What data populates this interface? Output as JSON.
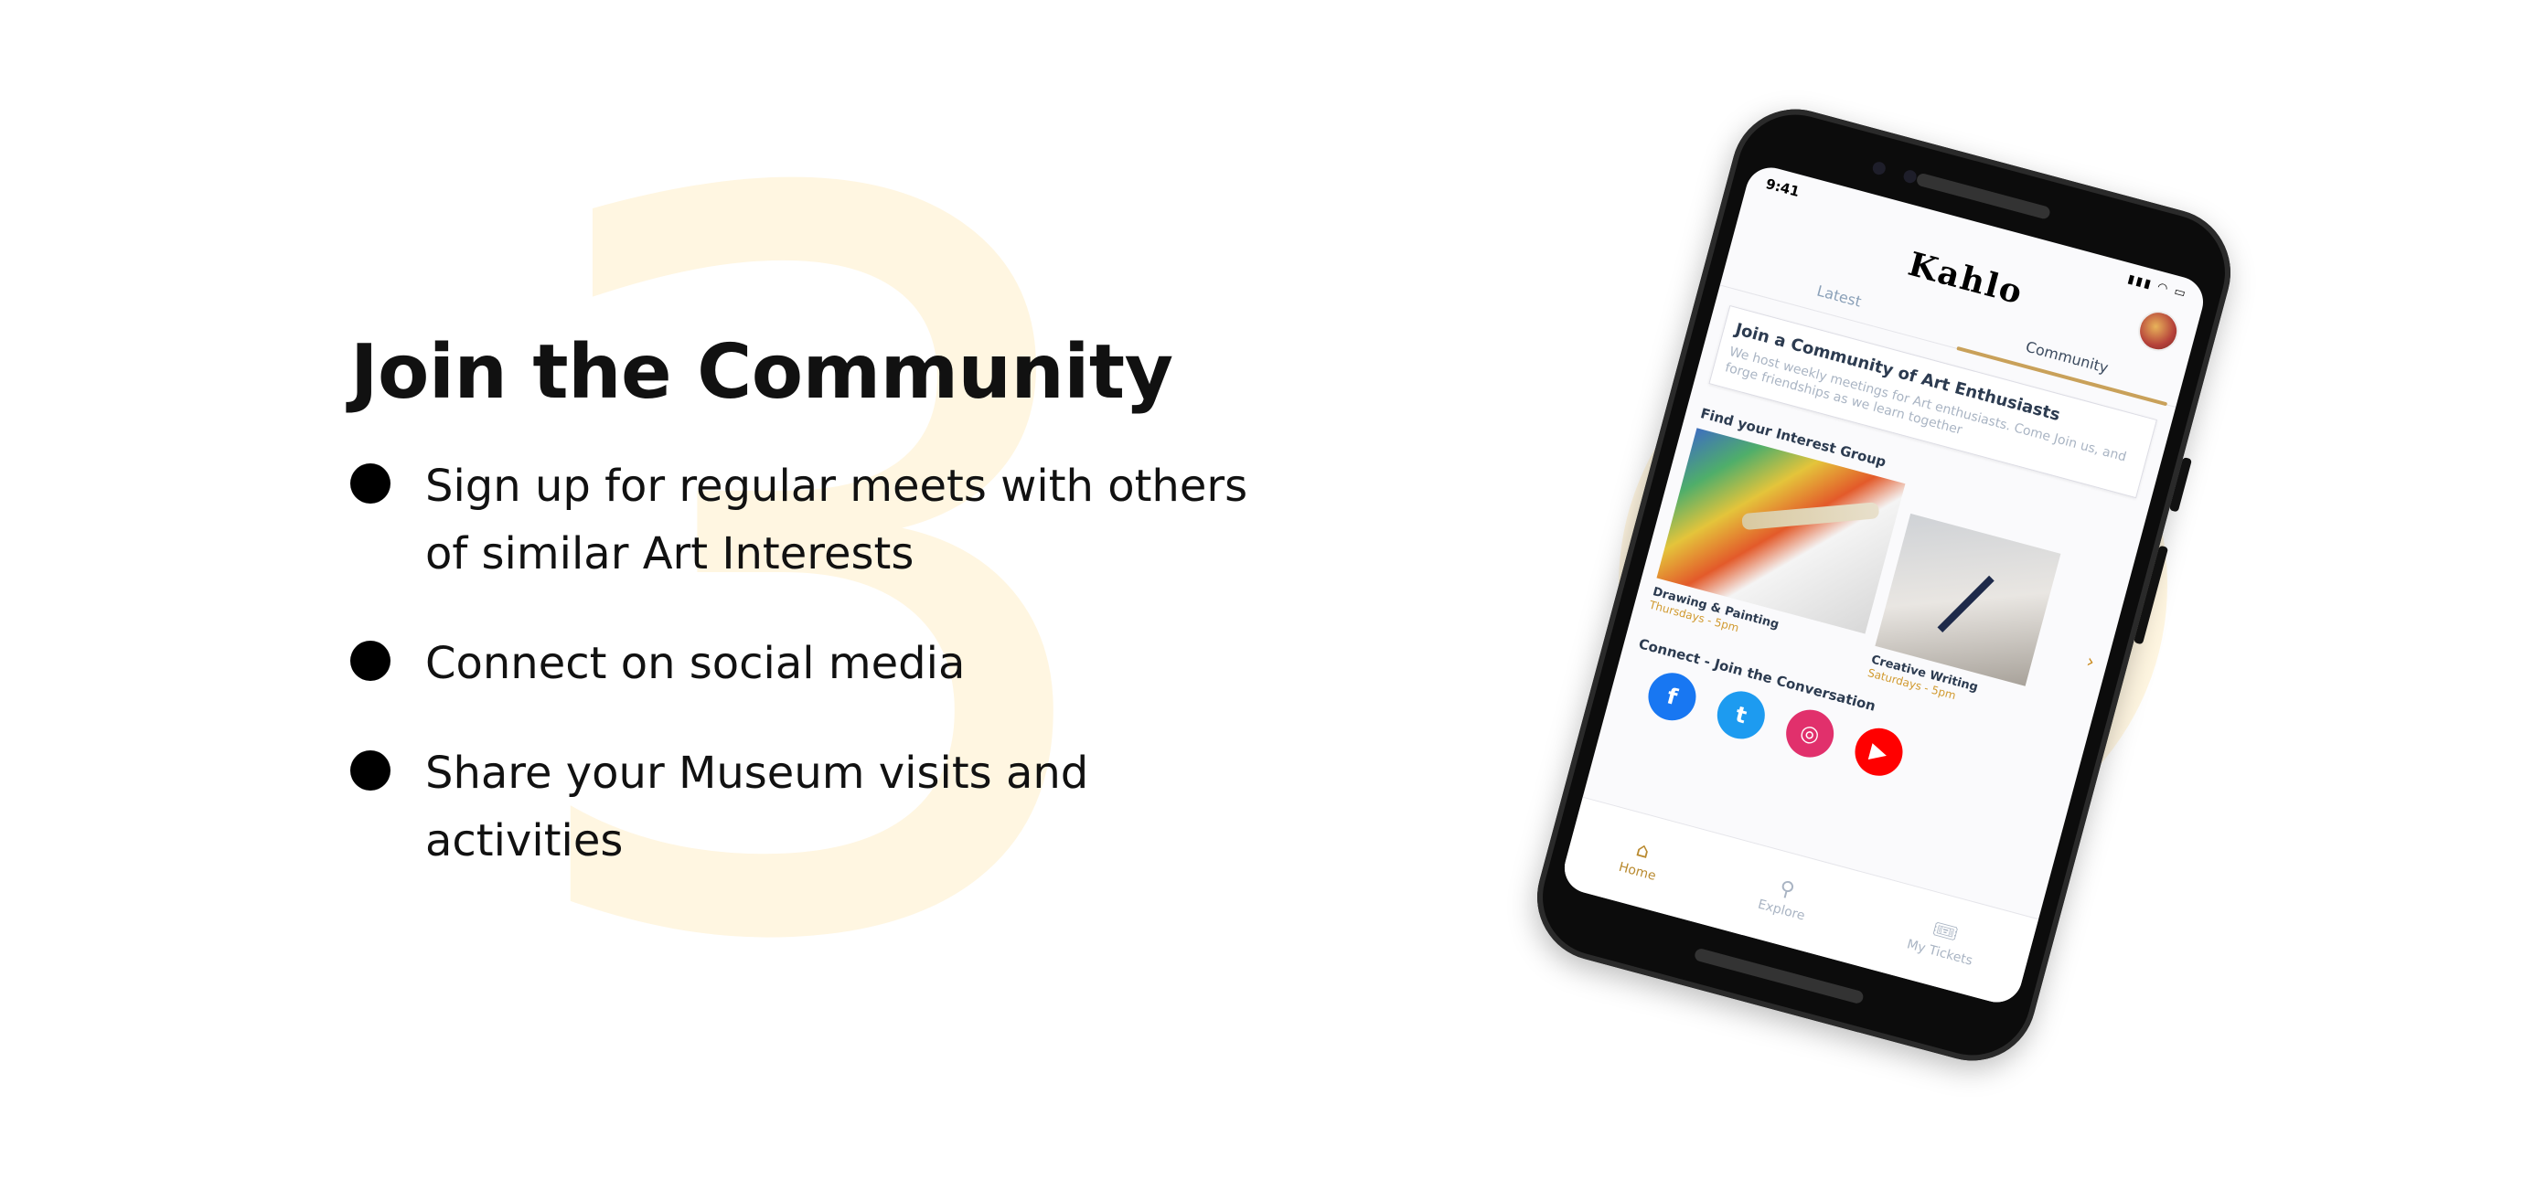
{
  "background_number": "3",
  "heading": "Join the Community",
  "bullets": [
    "Sign up for regular meets with others of similar Art Interests",
    "Connect on social media",
    "Share your Museum visits and activities"
  ],
  "phone": {
    "status": {
      "time": "9:41",
      "icons": [
        "signal-icon",
        "wifi-icon",
        "battery-icon"
      ]
    },
    "app_title": "Kahlo",
    "tabs": [
      "Latest",
      "Community"
    ],
    "active_tab": "Community",
    "promo": {
      "title": "Join a Community of Art Enthusiasts",
      "body": "We host weekly meetings for Art enthusiasts. Come Join us, and forge friendships as we learn together"
    },
    "interest_section_title": "Find your Interest Group",
    "groups": [
      {
        "name": "Drawing & Painting",
        "time": "Thursdays - 5pm"
      },
      {
        "name": "Creative Writing",
        "time": "Saturdays - 5pm"
      }
    ],
    "connect_title": "Connect - Join the Conversation",
    "socials": [
      "facebook-icon",
      "twitter-icon",
      "instagram-icon",
      "youtube-icon"
    ],
    "nav": [
      "Home",
      "Explore",
      "My Tickets"
    ],
    "active_nav": "Home"
  },
  "colors": {
    "accent_gold": "#c9a15a",
    "soft_cream": "#fff6e1",
    "facebook": "#1877f2",
    "twitter": "#1d9bf0",
    "instagram": "#e1306c",
    "youtube": "#ff0000"
  }
}
